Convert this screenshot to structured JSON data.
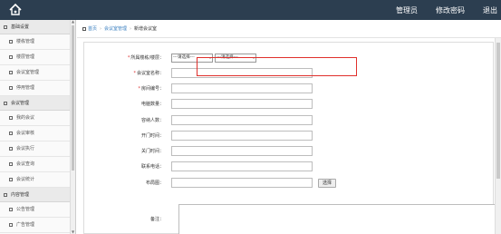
{
  "header": {
    "nav": [
      "管理员",
      "修改密码",
      "退出"
    ]
  },
  "sidebar": {
    "groups": [
      {
        "label": "基础设置",
        "items": [
          "楼栋管理",
          "楼层管理",
          "会议室管理",
          "停用管理"
        ]
      },
      {
        "label": "会议管理",
        "items": [
          "我的会议",
          "会议审核",
          "会议执行",
          "会议查询",
          "会议统计"
        ]
      },
      {
        "label": "内容管理",
        "items": [
          "公告管理",
          "广告管理"
        ]
      }
    ]
  },
  "breadcrumb": {
    "home": "首页",
    "parent": "会议室管理",
    "current": "新增会议室"
  },
  "form": {
    "building_floor": {
      "label": "所属楼栋/楼层：",
      "select1": "---请选择---",
      "select2": "---请选择---"
    },
    "room_name": {
      "label": "会议室名称："
    },
    "room_number": {
      "label": "房间编号："
    },
    "computers": {
      "label": "电脑数量："
    },
    "capacity": {
      "label": "容纳人数："
    },
    "open_time": {
      "label": "开门时间："
    },
    "close_time": {
      "label": "关门时间："
    },
    "phone": {
      "label": "联系电话："
    },
    "layout": {
      "label": "布局图：",
      "button": "选择"
    },
    "remarks": {
      "label": "备注："
    }
  },
  "colors": {
    "topbar": "#2c3e50",
    "highlight": "#e0302c",
    "link": "#3a7fc0",
    "required": "#dd3333"
  }
}
